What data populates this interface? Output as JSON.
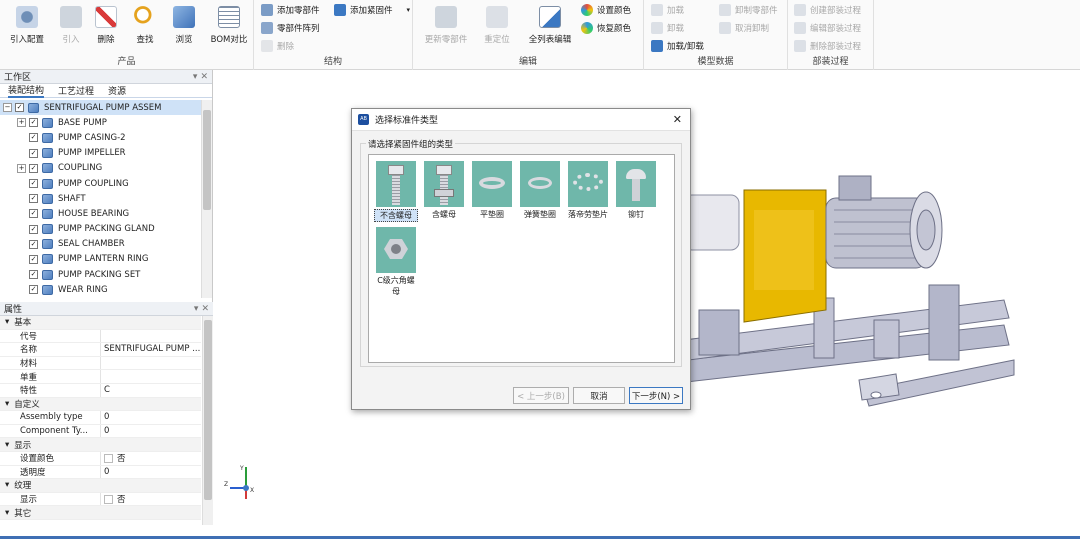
{
  "ribbon": {
    "product": {
      "label": "产品",
      "import_config": "引入配置",
      "import": "引入",
      "delete": "删除",
      "find": "查找",
      "browse": "浏览",
      "bom": "BOM对比"
    },
    "structure": {
      "label": "结构",
      "add_part": "添加零部件",
      "add_fastener": "添加紧固件",
      "part_array": "零部件阵列",
      "delete": "删除"
    },
    "edit": {
      "label": "编辑",
      "update": "更新零部件",
      "relocate": "重定位",
      "list_edit": "全列表编辑",
      "set_color": "设置颜色",
      "restore_color": "恢复颜色"
    },
    "model": {
      "label": "模型数据",
      "load": "加载",
      "unload": "卸载",
      "load_unload": "加载/卸载",
      "unload_part": "卸制零部件",
      "cancel_unload": "取消卸制"
    },
    "process": {
      "label": "部装过程",
      "create": "创建部装过程",
      "edit": "编辑部装过程",
      "delete": "删除部装过程"
    }
  },
  "workspace": {
    "title": "工作区",
    "tabs": [
      "装配结构",
      "工艺过程",
      "资源"
    ],
    "tree": {
      "root": "SENTRIFUGAL PUMP ASSEM",
      "items": [
        "BASE PUMP",
        "PUMP CASING-2",
        "PUMP IMPELLER",
        "COUPLING",
        "PUMP COUPLING",
        "SHAFT",
        "HOUSE BEARING",
        "PUMP PACKING GLAND",
        "SEAL CHAMBER",
        "PUMP LANTERN RING",
        "PUMP PACKING SET",
        "WEAR RING"
      ]
    }
  },
  "properties": {
    "title": "属性",
    "basic": "基本",
    "code": "代号",
    "name": "名称",
    "name_value": "SENTRIFUGAL PUMP ...",
    "material": "材料",
    "weight": "单重",
    "feature": "特性",
    "feature_value": "C",
    "custom": "自定义",
    "assembly_type": "Assembly type",
    "assembly_type_value": "0",
    "component_type": "Component Ty...",
    "component_type_value": "0",
    "display": "显示",
    "set_color": "设置颜色",
    "set_color_value": "否",
    "transparency": "透明度",
    "transparency_value": "0",
    "texture": "纹理",
    "show": "显示",
    "show_value": "否",
    "other": "其它"
  },
  "dialog": {
    "title": "选择标准件类型",
    "group_label": "请选择紧固件组的类型",
    "items": [
      "不含螺母",
      "含螺母",
      "平垫圈",
      "弹簧垫圈",
      "落帝劳垫片",
      "铆钉",
      "C级六角螺母"
    ],
    "prev": "< 上一步(B)",
    "cancel": "取消",
    "next": "下一步(N) >"
  },
  "axis": {
    "x": "X",
    "y": "Y",
    "z": "Z"
  },
  "colors": {
    "accent": "#3b78c2",
    "tile_bg": "#6fb7aa",
    "coupling_yellow": "#e8b800"
  }
}
